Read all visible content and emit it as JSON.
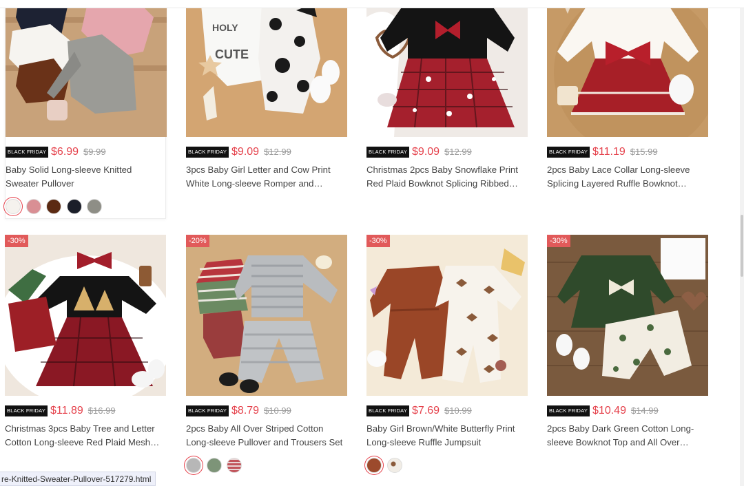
{
  "badge_text": "BLACK FRIDAY",
  "status_url": "re-Knitted-Sweater-Pullover-517279.html",
  "colors": {
    "price": "#e5414b",
    "discount_bg": "#e15a5a",
    "badge_bg": "#111111"
  },
  "products": [
    {
      "title": "Baby Solid Long-sleeve Knitted Sweater Pullover",
      "price": "$6.99",
      "old_price": "$9.99",
      "discount": "",
      "image": "knit-sweaters",
      "swatches": [
        "#f5f2ee",
        "#d98f94",
        "#5b2a12",
        "#1b1e29",
        "#8e8e86"
      ]
    },
    {
      "title": "3pcs Baby Girl Letter and Cow Print White Long-sleeve Romper and…",
      "price": "$9.09",
      "old_price": "$12.99",
      "discount": "",
      "image": "cow-romper",
      "swatches": []
    },
    {
      "title": "Christmas 2pcs Baby Snowflake Print Red Plaid Bowknot Splicing Ribbed…",
      "price": "$9.09",
      "old_price": "$12.99",
      "discount": "",
      "image": "plaid-dress",
      "swatches": []
    },
    {
      "title": "2pcs Baby Lace Collar Long-sleeve Splicing Layered Ruffle Bowknot…",
      "price": "$11.19",
      "old_price": "$15.99",
      "discount": "",
      "image": "ruffle-dress",
      "swatches": []
    },
    {
      "title": "Christmas 3pcs Baby Tree and Letter Cotton Long-sleeve Red Plaid Mesh…",
      "price": "$11.89",
      "old_price": "$16.99",
      "discount": "-30%",
      "image": "tree-dress",
      "swatches": []
    },
    {
      "title": "2pcs Baby All Over Striped Cotton Long-sleeve Pullover and Trousers Set",
      "price": "$8.79",
      "old_price": "$10.99",
      "discount": "-20%",
      "image": "striped-set",
      "swatches": [
        "#b7b7b7",
        "#7d9478",
        "#c1545b"
      ]
    },
    {
      "title": "Baby Girl Brown/White Butterfly Print Long-sleeve Ruffle Jumpsuit",
      "price": "$7.69",
      "old_price": "$10.99",
      "discount": "-30%",
      "image": "butterfly-jumpsuit",
      "swatches": [
        "#9c4a2c",
        "#e6e1d8"
      ]
    },
    {
      "title": "2pcs Baby Dark Green Cotton Long-sleeve Bowknot Top and All Over…",
      "price": "$10.49",
      "old_price": "$14.99",
      "discount": "-30%",
      "image": "green-set",
      "swatches": []
    }
  ]
}
